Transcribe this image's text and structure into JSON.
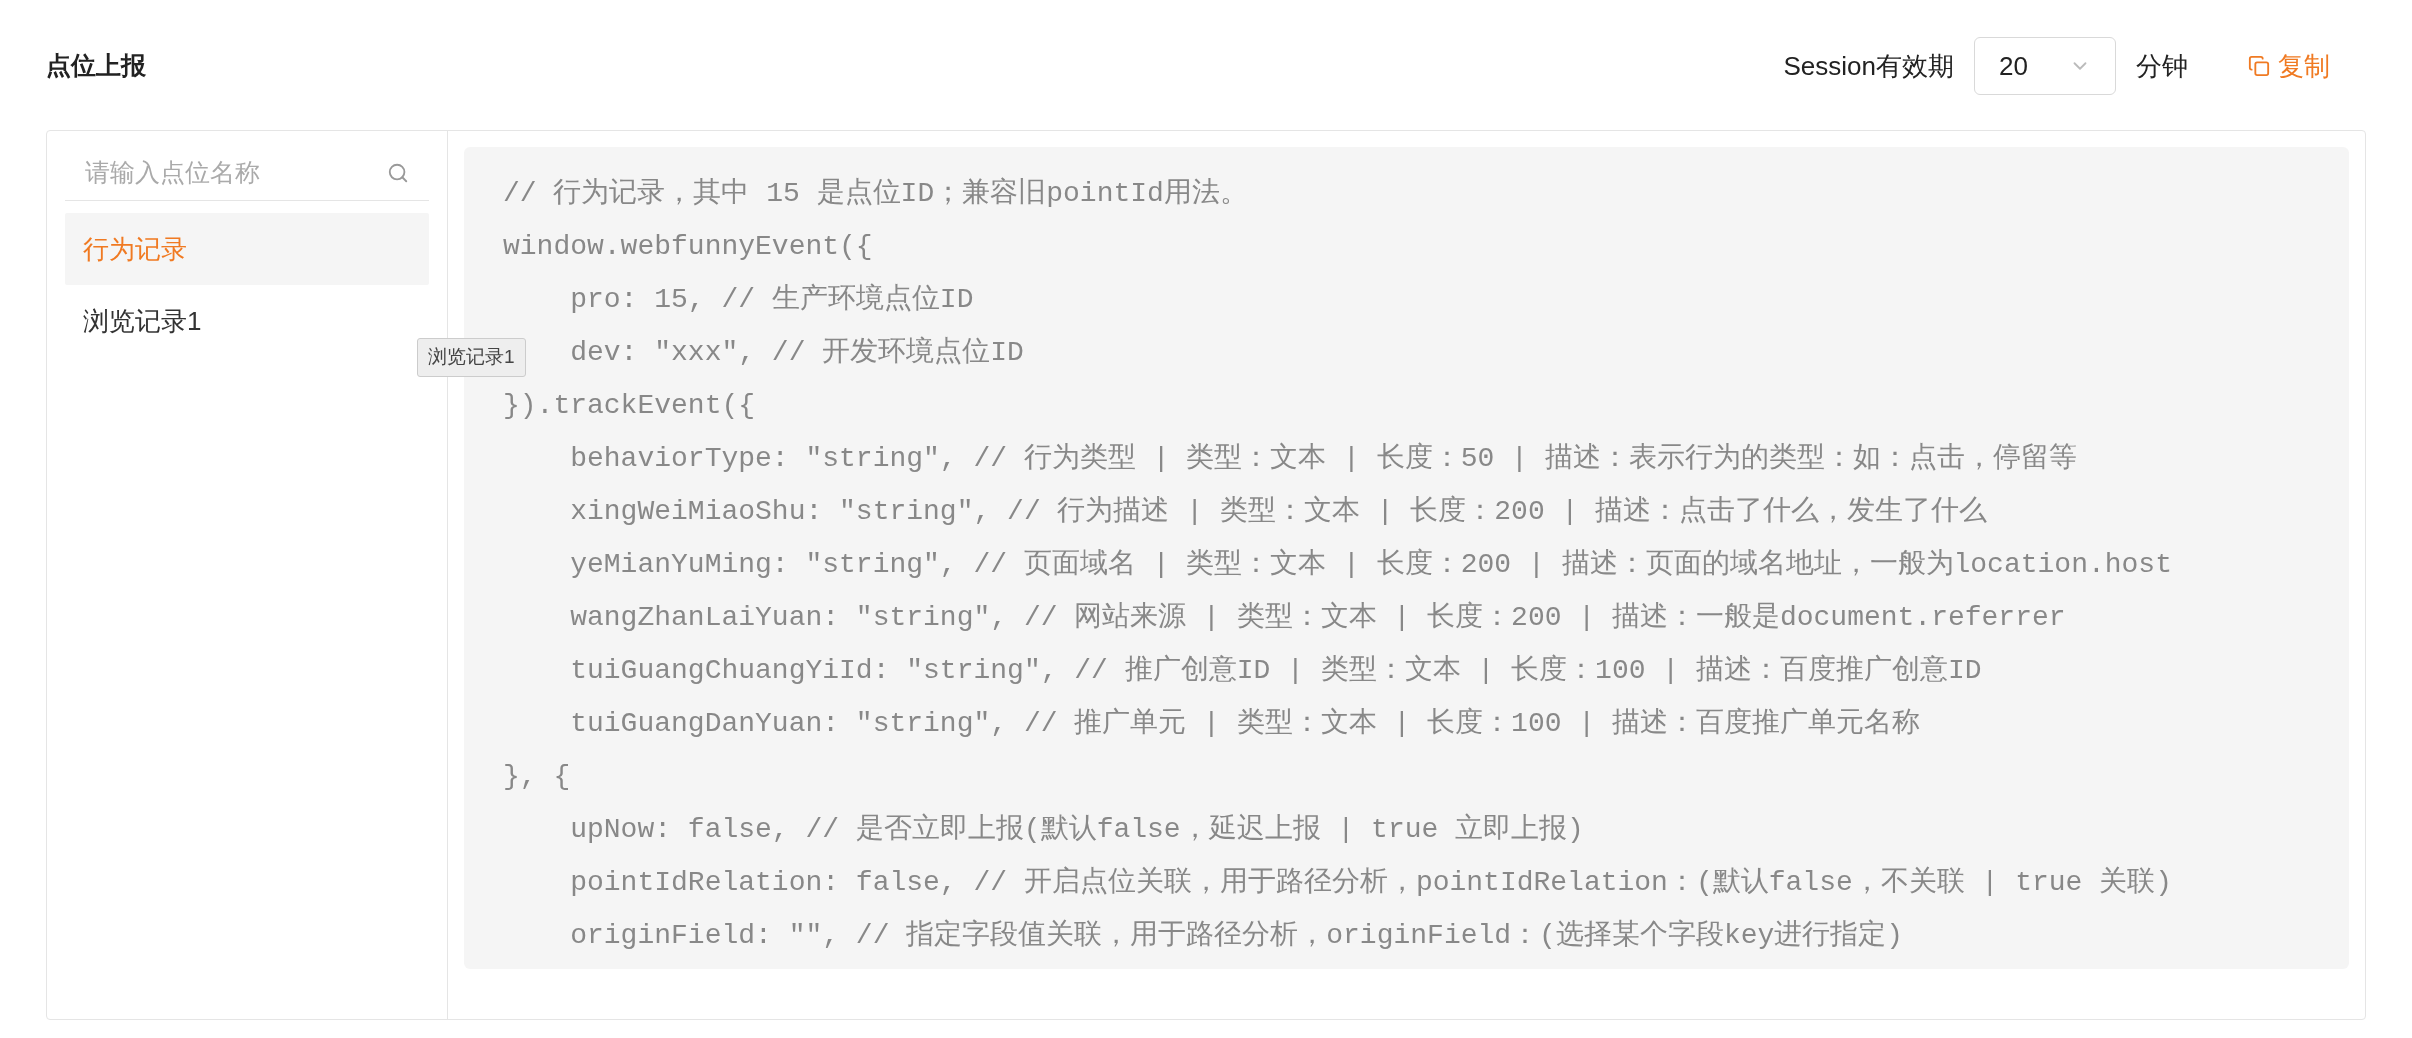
{
  "header": {
    "title": "点位上报",
    "session_label": "Session有效期",
    "session_select": {
      "value": "20"
    },
    "unit": "分钟",
    "copy_link": "复制"
  },
  "sidebar": {
    "search": {
      "placeholder": "请输入点位名称"
    },
    "items": [
      {
        "label": "行为记录",
        "selected": true
      },
      {
        "label": "浏览记录1",
        "selected": false
      }
    ],
    "tooltip": "浏览记录1"
  },
  "code": {
    "lines": [
      "// 行为记录，其中 15 是点位ID；兼容旧pointId用法。",
      "window.webfunnyEvent({",
      "    pro: 15, // 生产环境点位ID",
      "    dev: \"xxx\", // 开发环境点位ID",
      "}).trackEvent({",
      "    behaviorType: \"string\", // 行为类型 | 类型：文本 | 长度：50 | 描述：表示行为的类型：如：点击，停留等",
      "    xingWeiMiaoShu: \"string\", // 行为描述 | 类型：文本 | 长度：200 | 描述：点击了什么，发生了什么",
      "    yeMianYuMing: \"string\", // 页面域名 | 类型：文本 | 长度：200 | 描述：页面的域名地址，一般为location.host",
      "    wangZhanLaiYuan: \"string\", // 网站来源 | 类型：文本 | 长度：200 | 描述：一般是document.referrer",
      "    tuiGuangChuangYiId: \"string\", // 推广创意ID | 类型：文本 | 长度：100 | 描述：百度推广创意ID",
      "    tuiGuangDanYuan: \"string\", // 推广单元 | 类型：文本 | 长度：100 | 描述：百度推广单元名称",
      "}, {",
      "    upNow: false, // 是否立即上报(默认false，延迟上报 | true 立即上报)",
      "    pointIdRelation: false, // 开启点位关联，用于路径分析，pointIdRelation：(默认false，不关联 | true 关联)",
      "    originField: \"\", // 指定字段值关联，用于路径分析，originField：(选择某个字段key进行指定)"
    ]
  }
}
